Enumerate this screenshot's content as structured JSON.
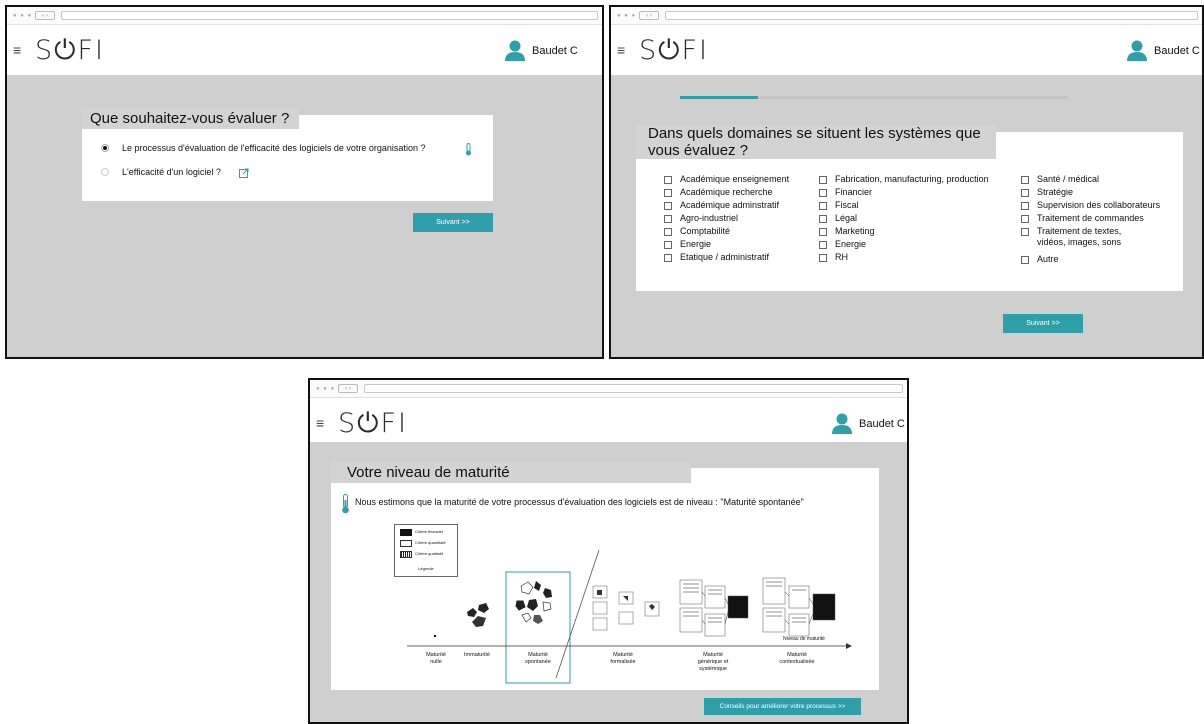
{
  "app": {
    "logo": "S⏻FI",
    "user_name": "Baudet C"
  },
  "screen1": {
    "question": "Que souhaitez-vous évaluer ?",
    "options": [
      {
        "label": "Le processus d'évaluation de l'efficacité des logiciels de votre organisation ?",
        "selected": true,
        "icon": "thermometer-icon"
      },
      {
        "label": "L'efficacité d'un logiciel ?",
        "selected": false,
        "icon": "external-link-icon"
      }
    ],
    "next_button": "Suivant >>"
  },
  "screen2": {
    "question_line1": "Dans quels domaines se situent les systèmes que",
    "question_line2": "vous évaluez ?",
    "progress": 0.2,
    "col1": [
      "Académique enseignement",
      "Académique recherche",
      "Académique adminstratif",
      "Agro-industriel",
      "Comptabilité",
      "Energie",
      "Etatique / administratif"
    ],
    "col2": [
      "Fabrication, manufacturing, production",
      "Financier",
      "Fiscal",
      "Légal",
      "Marketing",
      "Energie",
      "RH"
    ],
    "col3": [
      "Santé / médical",
      "Stratégie",
      "Supervision des collaborateurs",
      "Traitement de commandes",
      "Traitement de textes,",
      "Autre"
    ],
    "col3_continuation": "vidéos, images, sons",
    "next_button": "Suivant >>"
  },
  "screen3": {
    "title": "Votre niveau de maturité",
    "statement": "Nous estimons que la maturité de votre processus d'évaluation des logiciels est de niveau : \"Maturité spontanée\"",
    "legend": {
      "items": [
        "Critère financier",
        "Critère quantitatif",
        "Critère qualitatif"
      ],
      "title": "Légende"
    },
    "axis_label": "Niveau de maturité",
    "levels": [
      {
        "line1": "Maturité",
        "line2": "nulle",
        "line3": ""
      },
      {
        "line1": "Immaturité",
        "line2": "",
        "line3": ""
      },
      {
        "line1": "Maturité",
        "line2": "spontanée",
        "line3": ""
      },
      {
        "line1": "Maturité",
        "line2": "formalisée",
        "line3": ""
      },
      {
        "line1": "Maturité",
        "line2": "générique et",
        "line3": "systémique"
      },
      {
        "line1": "Maturité",
        "line2": "contextualisée",
        "line3": ""
      }
    ],
    "highlighted_level": "Maturité spontanée",
    "advice_button": "Conseils pour améliorer votre processus >>"
  },
  "colors": {
    "accent": "#2f9fa9",
    "workspace": "#cfcfcf",
    "title_bar": "#d3d3d3"
  }
}
